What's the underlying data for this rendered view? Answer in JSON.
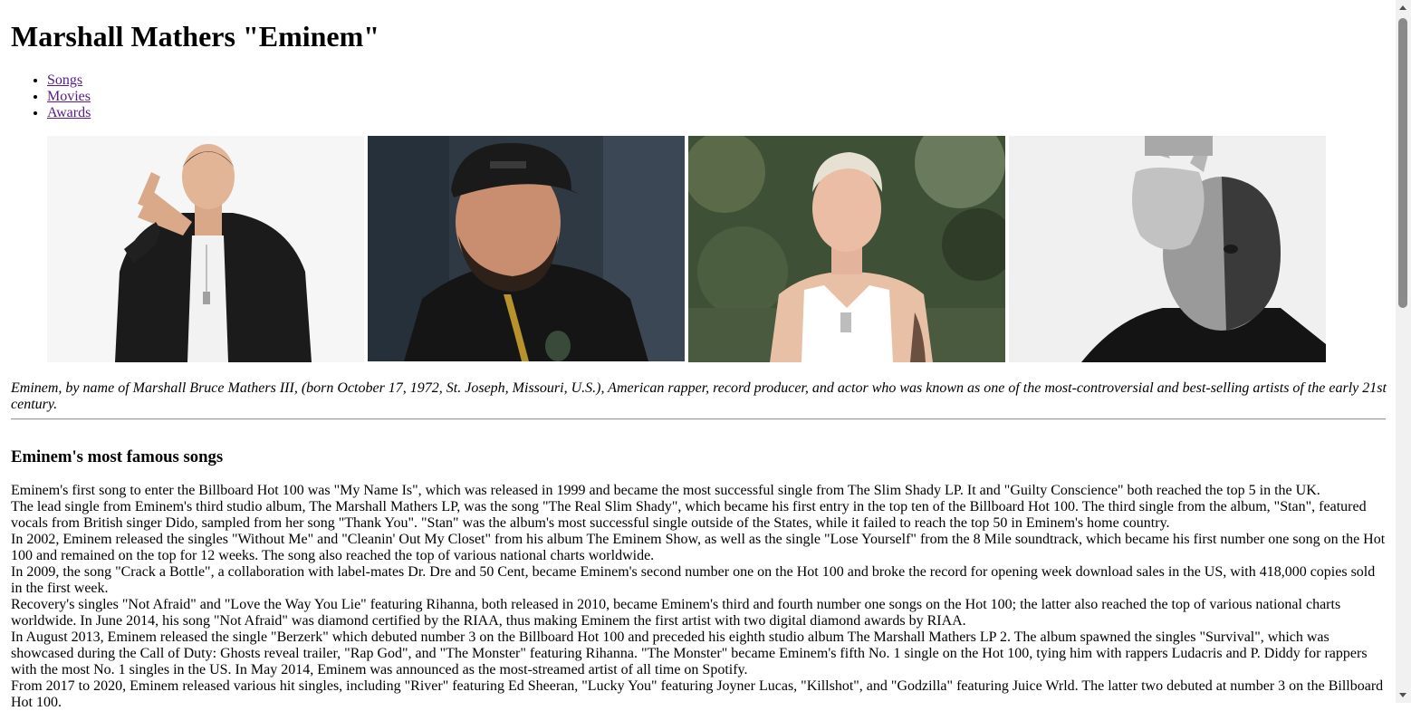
{
  "header": {
    "title": "Marshall Mathers \"Eminem\""
  },
  "nav": {
    "items": [
      "Songs",
      "Movies",
      "Awards"
    ]
  },
  "intro": "Eminem, by name of Marshall Bruce Mathers III, (born October 17, 1972, St. Joseph, Missouri, U.S.), American rapper, record producer, and actor who was known as one of the most-controversial and best-selling artists of the early 21st century.",
  "songs_section": {
    "heading": "Eminem's most famous songs",
    "paragraphs": [
      "Eminem's first song to enter the Billboard Hot 100 was \"My Name Is\", which was released in 1999 and became the most successful single from The Slim Shady LP. It and \"Guilty Conscience\" both reached the top 5 in the UK.",
      "The lead single from Eminem's third studio album, The Marshall Mathers LP, was the song \"The Real Slim Shady\", which became his first entry in the top ten of the Billboard Hot 100. The third single from the album, \"Stan\", featured vocals from British singer Dido, sampled from her song \"Thank You\". \"Stan\" was the album's most successful single outside of the States, while it failed to reach the top 50 in Eminem's home country.",
      "In 2002, Eminem released the singles \"Without Me\" and \"Cleanin' Out My Closet\" from his album The Eminem Show, as well as the single \"Lose Yourself\" from the 8 Mile soundtrack, which became his first number one song on the Hot 100 and remained on the top for 12 weeks. The song also reached the top of various national charts worldwide.",
      "In 2009, the song \"Crack a Bottle\", a collaboration with label-mates Dr. Dre and 50 Cent, became Eminem's second number one on the Hot 100 and broke the record for opening week download sales in the US, with 418,000 copies sold in the first week.",
      "Recovery's singles \"Not Afraid\" and \"Love the Way You Lie\" featuring Rihanna, both released in 2010, became Eminem's third and fourth number one songs on the Hot 100; the latter also reached the top of various national charts worldwide. In June 2014, his song \"Not Afraid\" was diamond certified by the RIAA, thus making Eminem the first artist with two digital diamond awards by RIAA.",
      "In August 2013, Eminem released the single \"Berzerk\" which debuted number 3 on the Billboard Hot 100 and preceded his eighth studio album The Marshall Mathers LP 2. The album spawned the singles \"Survival\", which was showcased during the Call of Duty: Ghosts reveal trailer, \"Rap God\", and \"The Monster\" featuring Rihanna. \"The Monster\" became Eminem's fifth No. 1 single on the Hot 100, tying him with rappers Ludacris and P. Diddy for rappers with the most No. 1 singles in the US. In May 2014, Eminem was announced as the most-streamed artist of all time on Spotify.",
      "From 2017 to 2020, Eminem released various hit singles, including \"River\" featuring Ed Sheeran, \"Lucky You\" featuring Joyner Lucas, \"Killshot\", and \"Godzilla\" featuring Juice Wrld. The latter two debuted at number 3 on the Billboard Hot 100."
    ]
  }
}
